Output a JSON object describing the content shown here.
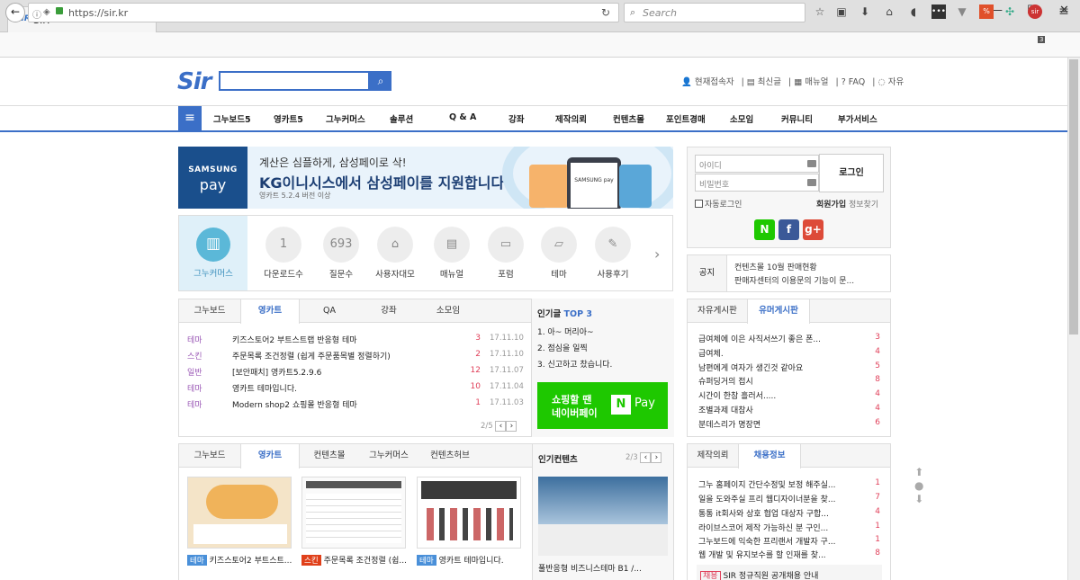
{
  "browser": {
    "tab_title": "SIR",
    "tab_icon": "SIR",
    "url": "https://sir.kr",
    "search_placeholder": "Search",
    "notification_count": "3"
  },
  "header": {
    "logo": "Sir",
    "top_links": [
      "현재접속자",
      "최신글",
      "매뉴얼",
      "FAQ",
      "자유"
    ]
  },
  "menu": [
    "그누보드5",
    "영카트5",
    "그누커머스",
    "솔루션",
    "Q & A",
    "강좌",
    "제작의뢰",
    "컨텐츠몰",
    "포인트경매",
    "소모임",
    "커뮤니티",
    "부가서비스"
  ],
  "banner": {
    "brand_top": "SAMSUNG",
    "brand_bottom": "pay",
    "line1": "계산은 심플하게, 삼성페이로 삭!",
    "line2": "KG이니시스에서 삼성페이를 지원합니다.",
    "line3": "영카트 5.2.4 버전 이상",
    "phone_label": "SAMSUNG pay"
  },
  "icons": {
    "feature_label": "그누커머스",
    "items": [
      {
        "icon": "1",
        "label": "다운로드수"
      },
      {
        "icon": "693",
        "label": "질문수"
      },
      {
        "icon": "⌂",
        "label": "사용자대모"
      },
      {
        "icon": "▤",
        "label": "매뉴얼"
      },
      {
        "icon": "▭",
        "label": "포럼"
      },
      {
        "icon": "▱",
        "label": "테마"
      },
      {
        "icon": "✎",
        "label": "사용후기"
      }
    ]
  },
  "board1": {
    "tabs": [
      "그누보드",
      "영카트",
      "QA",
      "강좌",
      "소모임"
    ],
    "active": 1,
    "rows": [
      {
        "cat": "테마",
        "title": "키즈스토어2 부트스트랩 반응형 테마",
        "count": "3",
        "date": "17.11.10"
      },
      {
        "cat": "스킨",
        "title": "주문목록 조건정렬 (쉽게 주문품목별 정렬하기)",
        "count": "2",
        "date": "17.11.10"
      },
      {
        "cat": "일반",
        "title": "[보안패치] 영카트5.2.9.6",
        "count": "12",
        "date": "17.11.07"
      },
      {
        "cat": "테마",
        "title": "영카트 테마입니다.",
        "count": "10",
        "date": "17.11.04"
      },
      {
        "cat": "테마",
        "title": "Modern shop2 쇼핑몰 반응형 테마",
        "count": "1",
        "date": "17.11.03"
      }
    ],
    "pager": "2/5"
  },
  "popular": {
    "title": "인기글",
    "top": "TOP 3",
    "items": [
      "1. 아~ 머리아~",
      "2. 점심을 일찍",
      "3. 신고하고 찼습니다."
    ]
  },
  "npay": {
    "line1": "쇼핑할 땐",
    "line2": "네이버페이",
    "logo": "N",
    "pay": "Pay"
  },
  "login": {
    "id_placeholder": "아이디",
    "pw_placeholder": "비밀번호",
    "button": "로그인",
    "auto": "자동로그인",
    "join": "회원가입",
    "find": "정보찾기"
  },
  "sns": [
    {
      "label": "N",
      "color": "#1ec800"
    },
    {
      "label": "f",
      "color": "#3b5998"
    },
    {
      "label": "g+",
      "color": "#dd4b39"
    }
  ],
  "notice": {
    "title": "공지",
    "lines": [
      "컨텐츠몰 10월 판매현황",
      "판매자센터의 이용문의 기능이 문..."
    ]
  },
  "board2": {
    "tabs": [
      "자유게시판",
      "유머게시판"
    ],
    "active": 1,
    "rows": [
      {
        "title": "급여체에 이은 사직서쓰기 좋은 폰...",
        "count": "3"
      },
      {
        "title": "급여체.",
        "count": "4"
      },
      {
        "title": "남편에게 여자가 생긴것 같아요",
        "count": "5"
      },
      {
        "title": "슈퍼딩거의 접시",
        "count": "8"
      },
      {
        "title": "시간이 한참 흘러서.....",
        "count": "4"
      },
      {
        "title": "조별과제 대참사",
        "count": "4"
      },
      {
        "title": "분데스리가 명장면",
        "count": "6"
      }
    ]
  },
  "board3": {
    "tabs": [
      "그누보드",
      "영카트",
      "컨텐츠몰",
      "그누커머스",
      "컨텐츠허브"
    ],
    "active": 1,
    "cards": [
      {
        "badge": "테마",
        "badge_color": "#4a90d9",
        "title": "키즈스토어2 부트스트..."
      },
      {
        "badge": "스킨",
        "badge_color": "#e0401a",
        "title": "주문목록 조건정렬 (쉽..."
      },
      {
        "badge": "테마",
        "badge_color": "#4a90d9",
        "title": "영카트 테마입니다."
      }
    ]
  },
  "content": {
    "title": "인기컨텐츠",
    "pager": "2/3",
    "item": "풀반응형 비즈니스테마 B1 /..."
  },
  "board4": {
    "tabs": [
      "제작의뢰",
      "채용정보"
    ],
    "active": 1,
    "rows": [
      {
        "title": "그누 홈페이지 간단수정및 보정 해주실...",
        "count": "1"
      },
      {
        "title": "일을 도와주실 프리 웹디자이너분을 찾...",
        "count": "7"
      },
      {
        "title": "통통 it회사와 상호 협업 대상자 구합...",
        "count": "4"
      },
      {
        "title": "라이브스코어 제작 가능하신 분 구인...",
        "count": "1"
      },
      {
        "title": "그누보드에 익숙한 프리랜서 개발자 구...",
        "count": "1"
      },
      {
        "title": "웹 개발 및 유지보수를 할 인재를 찾...",
        "count": "8"
      }
    ],
    "notice_badge": "채용",
    "notice_text": "SIR 정규직원 공개채용 안내"
  },
  "colors": {
    "accent": "#3b6fc7",
    "count": "#e0405a",
    "category": "#9b59b6",
    "npay": "#1ec800"
  }
}
